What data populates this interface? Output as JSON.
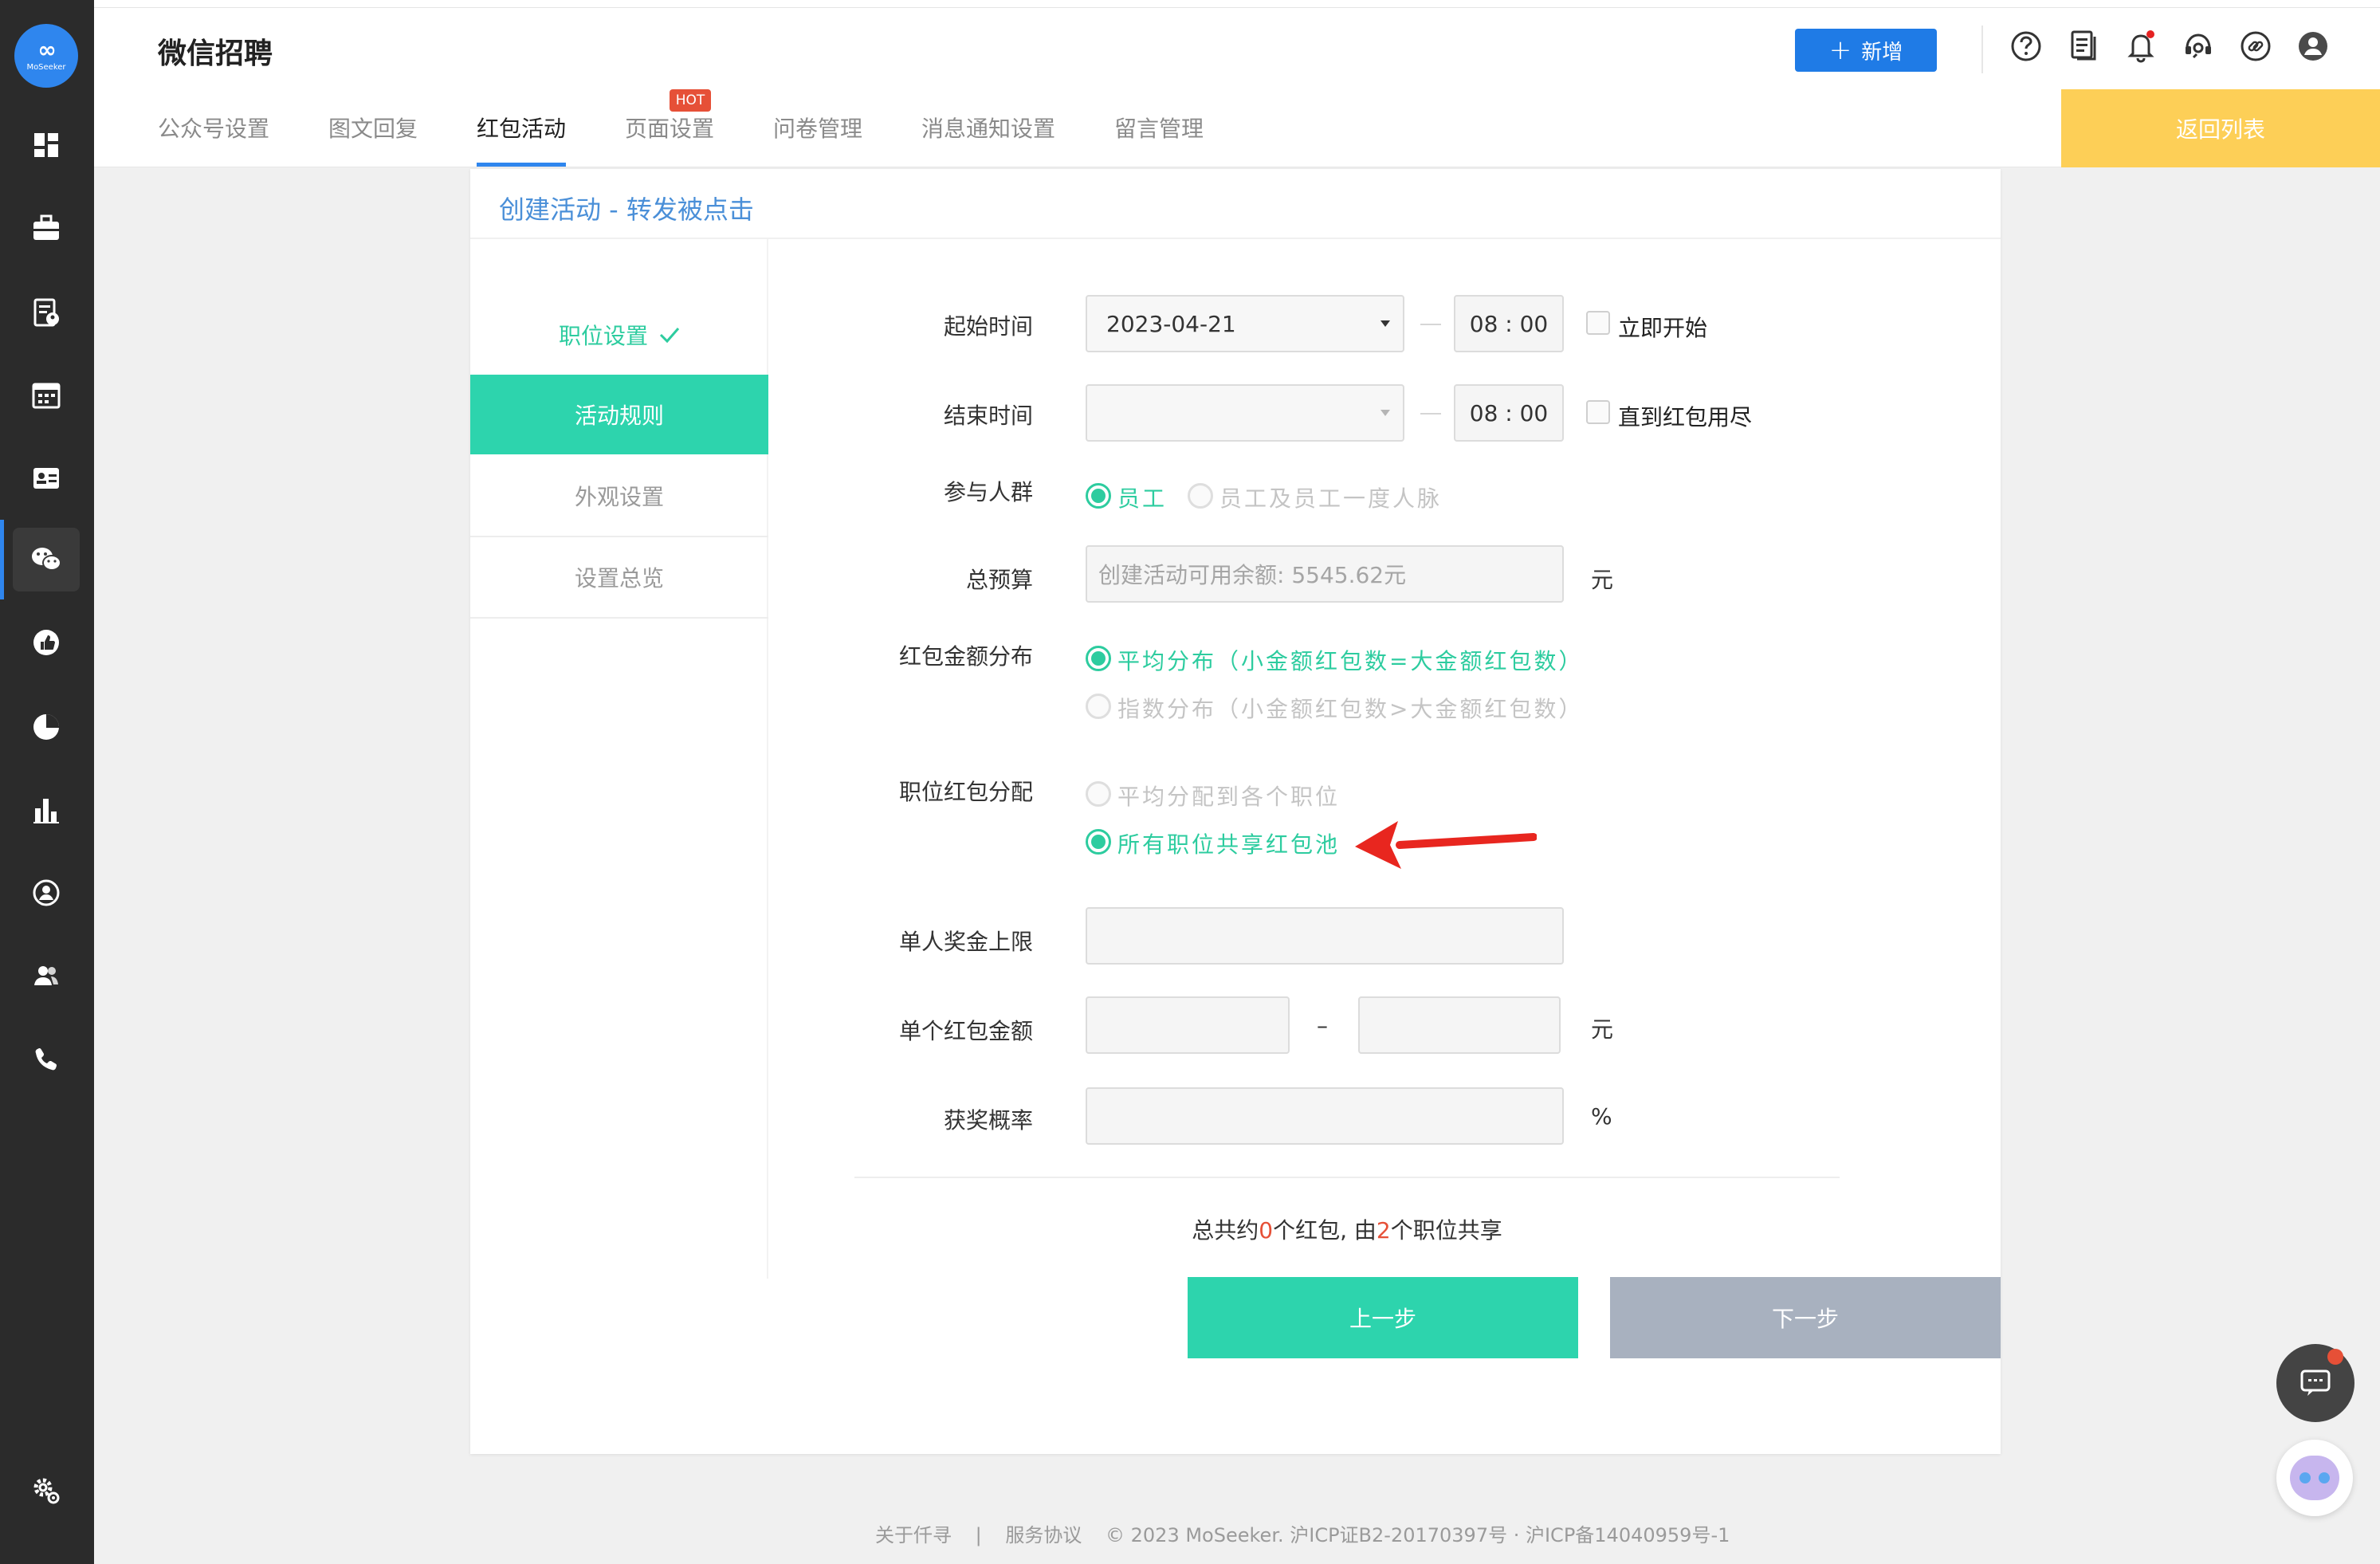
{
  "sidebar": {
    "logo_text": "MoSeeker",
    "items": [
      {
        "icon": "dashboard-icon"
      },
      {
        "icon": "briefcase-icon"
      },
      {
        "icon": "resume-icon"
      },
      {
        "icon": "calendar-icon"
      },
      {
        "icon": "id-card-icon"
      },
      {
        "icon": "wechat-icon"
      },
      {
        "icon": "thumbs-up-icon"
      },
      {
        "icon": "pie-chart-icon"
      },
      {
        "icon": "bar-chart-icon"
      },
      {
        "icon": "person-circle-icon"
      },
      {
        "icon": "users-icon"
      },
      {
        "icon": "phone-icon"
      },
      {
        "icon": "settings-icon"
      }
    ]
  },
  "header": {
    "title": "微信招聘",
    "add_button": "新增",
    "tabs": [
      "公众号设置",
      "图文回复",
      "红包活动",
      "页面设置",
      "问卷管理",
      "消息通知设置",
      "留言管理"
    ],
    "active_tab": "红包活动",
    "hot_badge": "HOT",
    "back_button": "返回列表",
    "icons": [
      "help-icon",
      "document-icon",
      "bell-icon",
      "support-icon",
      "link-icon",
      "user-icon"
    ]
  },
  "card": {
    "title": "创建活动 - 转发被点击",
    "steps": [
      "职位设置",
      "活动规则",
      "外观设置",
      "设置总览"
    ],
    "active_step": "活动规则",
    "completed_step": "职位设置"
  },
  "form": {
    "start_time": {
      "label": "起始时间",
      "date": "2023-04-21",
      "time": "08 : 00",
      "checkbox": "立即开始"
    },
    "end_time": {
      "label": "结束时间",
      "date": "",
      "time": "08 : 00",
      "checkbox": "直到红包用尽"
    },
    "audience": {
      "label": "参与人群",
      "option_selected": "员工",
      "option_disabled": "员工及员工一度人脉"
    },
    "budget": {
      "label": "总预算",
      "placeholder": "创建活动可用余额: 5545.62元",
      "unit": "元"
    },
    "distribution": {
      "label": "红包金额分布",
      "option_selected": "平均分布（小金额红包数=大金额红包数）",
      "option_disabled": "指数分布（小金额红包数>大金额红包数）"
    },
    "position_allocation": {
      "label": "职位红包分配",
      "option_disabled": "平均分配到各个职位",
      "option_selected": "所有职位共享红包池"
    },
    "max_per_person": {
      "label": "单人奖金上限",
      "value": ""
    },
    "single_amount": {
      "label": "单个红包金额",
      "min": "",
      "separator": "–",
      "max": "",
      "unit": "元"
    },
    "win_rate": {
      "label": "获奖概率",
      "value": "",
      "unit": "%"
    }
  },
  "summary": {
    "prefix": "总共约",
    "count": "0",
    "mid": "个红包, 由",
    "positions": "2",
    "suffix": "个职位共享"
  },
  "buttons": {
    "prev": "上一步",
    "next": "下一步"
  },
  "footer": {
    "about": "关于仟寻",
    "sep": "|",
    "terms": "服务协议",
    "copyright": "© 2023 MoSeeker. 沪ICP证B2-20170397号 · 沪ICP备14040959号-1"
  },
  "colors": {
    "primary": "#2dd4ad",
    "accent_blue": "#1f7be6",
    "back_button": "#fdcf57",
    "highlight": "#e65037"
  }
}
